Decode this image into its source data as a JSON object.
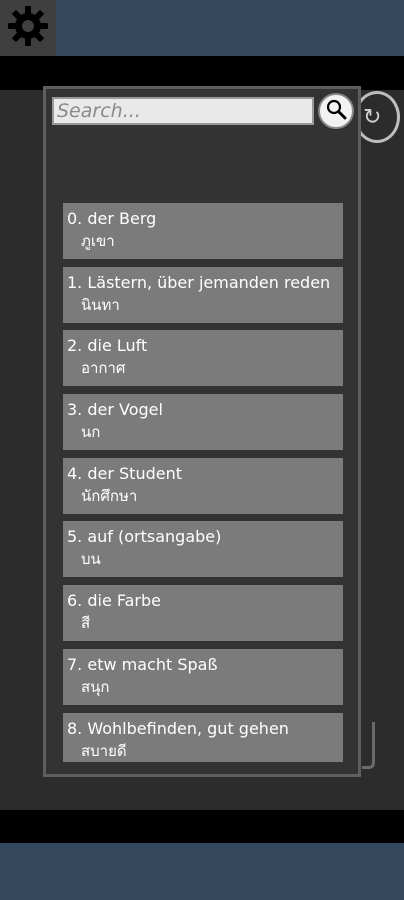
{
  "search": {
    "placeholder": "Search..."
  },
  "icons": {
    "settings": "gear-icon",
    "search": "search-icon",
    "refresh": "refresh-icon"
  },
  "words": [
    {
      "de": "0. der Berg",
      "th": "ภูเขา"
    },
    {
      "de": "1. Lästern, über jemanden reden",
      "th": "นินทา"
    },
    {
      "de": "2. die Luft",
      "th": "อากาศ"
    },
    {
      "de": "3. der Vogel",
      "th": "นก"
    },
    {
      "de": "4. der Student",
      "th": "นักศึกษา"
    },
    {
      "de": "5. auf (ortsangabe)",
      "th": "บน"
    },
    {
      "de": "6. die Farbe",
      "th": "สี"
    },
    {
      "de": "7. etw macht Spaß",
      "th": "สนุก"
    },
    {
      "de": "8. Wohlbefinden, gut gehen",
      "th": "สบายดี"
    }
  ],
  "colors": {
    "topbar": "#34495e",
    "item_bg": "#7b7b7b",
    "panel_bg": "#333333"
  }
}
